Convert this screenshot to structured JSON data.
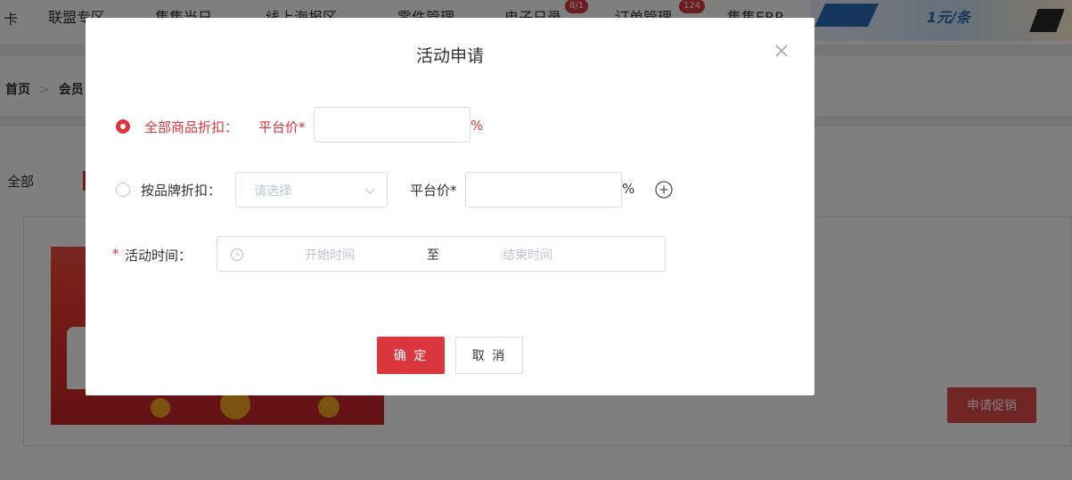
{
  "background": {
    "nav": {
      "edge_text": "卡",
      "items": [
        {
          "label": "联盟专区"
        },
        {
          "label": "集集当日"
        },
        {
          "label": "线上海报区"
        },
        {
          "label": "零件管理"
        },
        {
          "label": "电子日录",
          "badge": "8/1"
        },
        {
          "label": "订单管理",
          "badge": "124"
        },
        {
          "label": "集集ERP"
        }
      ],
      "banner_text": "1元/条"
    },
    "breadcrumb": {
      "home": "首页",
      "separator": ">",
      "current": "会员"
    },
    "tabs": {
      "all": "全部"
    },
    "apply_button": "申请促销"
  },
  "dialog": {
    "title": "活动申请",
    "option_all": {
      "label": "全部商品折扣：",
      "price_label": "平台价*",
      "value": "",
      "unit": "%",
      "selected": true
    },
    "option_brand": {
      "label": "按品牌折扣：",
      "select_placeholder": "请选择",
      "price_label": "平台价*",
      "value": "",
      "unit": "%",
      "selected": false
    },
    "activity_time": {
      "required_mark": "*",
      "label": "活动时间：",
      "start_placeholder": "开始时间",
      "separator": "至",
      "end_placeholder": "结束时间"
    },
    "confirm_button": "确 定",
    "cancel_button": "取 消"
  },
  "colors": {
    "accent": "#d9363e",
    "mask": "rgba(0,0,0,0.5)"
  }
}
